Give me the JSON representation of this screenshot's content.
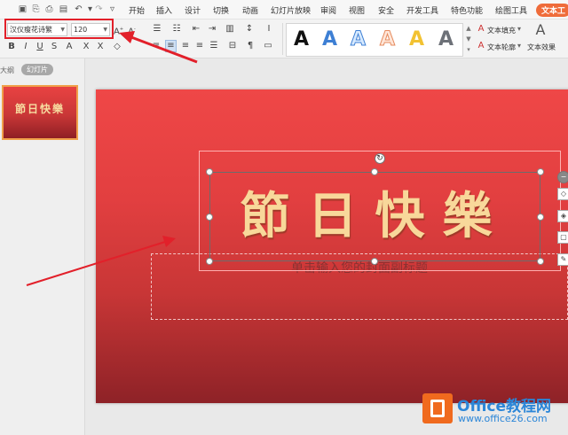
{
  "menubar": {
    "tabs": [
      "开始",
      "插入",
      "设计",
      "切换",
      "动画",
      "幻灯片放映",
      "审阅",
      "视图",
      "安全",
      "开发工具",
      "特色功能",
      "绘图工具"
    ],
    "active_tab": "文本工"
  },
  "ribbon": {
    "font_name": "汉仪瘦花诗繁",
    "font_size": "120",
    "style_letter": "A",
    "text_fill_label": "文本填充",
    "text_outline_label": "文本轮廓",
    "text_effects_label": "文本效果"
  },
  "left_pane": {
    "outline_tab": "大纲",
    "slides_tab": "幻灯片",
    "thumbnail_text": "節日快樂"
  },
  "slide": {
    "title": "節日快樂",
    "subtitle_placeholder": "单击输入您的封面副标题"
  },
  "watermark": {
    "title": "Office教程网",
    "url": "www.office26.com"
  },
  "colors": {
    "slide_top": "#ef4747",
    "slide_bottom": "#8e2227",
    "title_text": "#f8d89a",
    "active_tab": "#ef6c3a",
    "annotation_red": "#e2202a",
    "watermark_blue": "#2b86d8"
  }
}
